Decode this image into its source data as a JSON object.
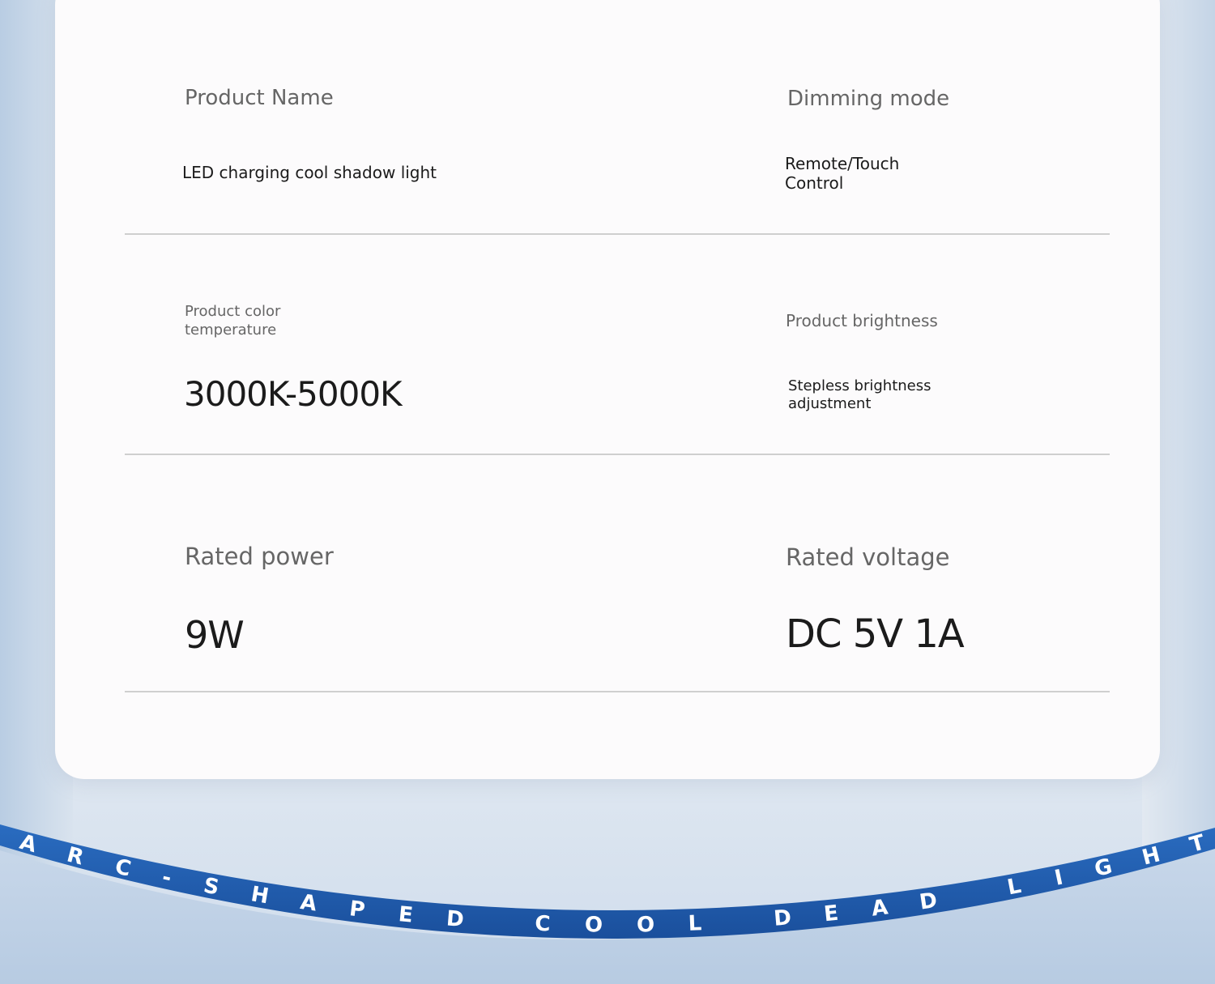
{
  "specs": {
    "product_name": {
      "label": "Product Name",
      "value": "LED charging cool shadow light"
    },
    "dimming_mode": {
      "label": "Dimming mode",
      "value_line1": "Remote/Touch",
      "value_line2": "Control"
    },
    "color_temperature": {
      "label_line1": "Product color",
      "label_line2": "temperature",
      "value": "3000K-5000K"
    },
    "brightness": {
      "label": "Product brightness",
      "value_line1": "Stepless brightness",
      "value_line2": "adjustment"
    },
    "rated_power": {
      "label": "Rated power",
      "value": "9W"
    },
    "rated_voltage": {
      "label": "Rated voltage",
      "value": "DC 5V 1A"
    }
  },
  "banner": {
    "letters": [
      "A",
      "R",
      "C",
      "-",
      "S",
      "H",
      "A",
      "P",
      "E",
      "D",
      "C",
      "O",
      "O",
      "L",
      "D",
      "E",
      "A",
      "D",
      "L",
      "I",
      "G",
      "H",
      "T"
    ],
    "color": "#1f5db0"
  }
}
